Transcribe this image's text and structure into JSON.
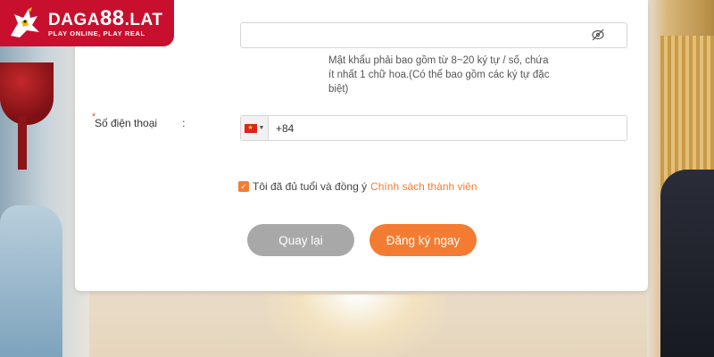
{
  "logo": {
    "brand_prefix": "DAGA",
    "brand_number": "88",
    "brand_suffix": ".LAT",
    "tagline": "PLAY ONLINE, PLAY REAL"
  },
  "form": {
    "password": {
      "value": "",
      "hint": "Mật khẩu phải bao gồm từ 8~20 ký tự / số, chứa ít nhất 1 chữ hoa.(Có thể bao gồm các ký tự đặc biệt)",
      "toggle_icon": "eye-slash-icon"
    },
    "phone": {
      "required_mark": "*",
      "label": "Số điện thoại",
      "colon": ":",
      "country_flag": "vietnam-flag-icon",
      "value": "+84"
    },
    "agree": {
      "checked": true,
      "text": "Tôi đã đủ tuổi và đồng ý",
      "link": "Chính sách thành viên"
    },
    "buttons": {
      "back": "Quay lại",
      "register": "Đăng ký ngay"
    }
  },
  "colors": {
    "accent": "#f47c32",
    "brand_red": "#c8102e",
    "button_gray": "#a8a8a8"
  }
}
